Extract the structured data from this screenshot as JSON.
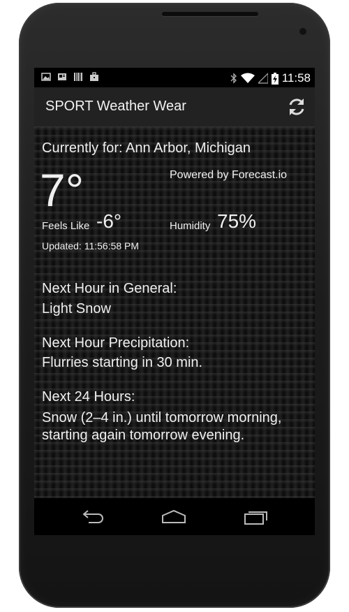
{
  "status_bar": {
    "time": "11:58",
    "left_icons": [
      "image-icon",
      "news-icon",
      "barcode-icon",
      "briefcase-icon"
    ],
    "right_icons": [
      "bluetooth-icon",
      "wifi-icon",
      "signal-icon",
      "battery-charging-icon"
    ]
  },
  "action_bar": {
    "title": "SPORT Weather Wear",
    "refresh_icon": "refresh-icon"
  },
  "weather": {
    "location_line": "Currently for: Ann Arbor, Michigan",
    "powered_by": "Powered by Forecast.io",
    "temperature": "7°",
    "feels_like_label": "Feels Like",
    "feels_like_value": "-6°",
    "humidity_label": "Humidity",
    "humidity_value": "75%",
    "updated": "Updated: 11:56:58 PM"
  },
  "sections": [
    {
      "label": "Next Hour in General:",
      "value": "Light Snow"
    },
    {
      "label": "Next Hour Precipitation:",
      "value": "Flurries starting in 30 min."
    },
    {
      "label": "Next 24 Hours:",
      "value": "Snow (2–4 in.) until tomorrow morning, starting again tomorrow evening."
    }
  ],
  "nav_bar": {
    "icons": [
      "back-icon",
      "home-icon",
      "recent-apps-icon"
    ]
  }
}
